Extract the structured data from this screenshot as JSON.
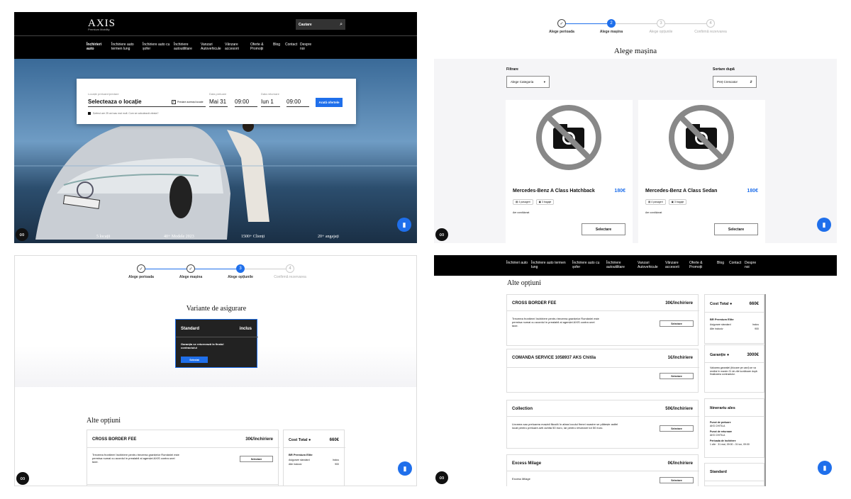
{
  "q1": {
    "brand": "AXIS",
    "brand_sub": "Premium Mobility",
    "search_placeholder": "Cautare",
    "nav": [
      "Închirieri auto",
      "Închiriere auto termen lung",
      "Închiriere auto cu șofer",
      "Închiriere autoutilitare",
      "Vanzari Autovehicule",
      "Vânzare accesorii",
      "Oferte & Promoții",
      "Blog",
      "Contact",
      "Despre noi"
    ],
    "form": {
      "loc_label": "Locație preluare/predare",
      "loc_value": "Selecteaza o locație",
      "same_label": "Predare aceeași locație",
      "pick_label": "Data preluare",
      "pick_date": "Mai 31",
      "pick_time": "09:00",
      "ret_label": "Data returnare",
      "ret_date": "Iun 1",
      "ret_time": "09:00",
      "cta": "Arată ofertele",
      "note": "Șoferul are 25 ani sau mai mult. Cum se calculează vârsta?"
    },
    "stats": [
      "5 locații",
      "40+ Modele 2023",
      "1500+ Clienți",
      "20+ angajați"
    ]
  },
  "steps": [
    "Alege perioada",
    "Alege mașina",
    "Alege opțiunile",
    "Confirmă rezervarea"
  ],
  "q2": {
    "title": "Alege mașina",
    "filter_label": "Filtrare",
    "filter_value": "Alege Categoria",
    "sort_label": "Sortare după",
    "sort_value": "Preț Crescator",
    "cars": [
      {
        "name": "Mercedes-Benz A Class Hatchback",
        "price": "180€",
        "pax": "4 pasageri",
        "bags": "3 bagaje",
        "feat": "Aer condiționat",
        "btn": "Selectare"
      },
      {
        "name": "Mercedes-Benz A Class Sedan",
        "price": "180€",
        "pax": "4 pasageri",
        "bags": "3 bagaje",
        "feat": "Aer condiționat",
        "btn": "Selectare"
      }
    ]
  },
  "q3": {
    "ins_title": "Variante de asigurare",
    "ins_name": "Standard",
    "ins_tag": "inclus",
    "ins_desc": "Garanția se returnează la finalul contractului",
    "ins_btn": "Selectat",
    "opts_title": "Alte opțiuni",
    "opt_name": "CROSS BORDER FEE",
    "opt_price": "30€/închiriere",
    "opt_desc": "Trecerea frontierei închiriere pentru trecerea granițelor României este permisa numai cu acordul in prealabil al agenției AXIS contra unei taxe.",
    "opt_btn": "Selectare",
    "cost_label": "Cost Total",
    "cost_value": "660€",
    "car": "BR Premium Elite",
    "line1": "Asigurare standard",
    "line1v": "Inclus",
    "line2": "Alte inclusiv",
    "line2v": "900"
  },
  "q4": {
    "nav": [
      "Închirieri auto",
      "Închiriere auto termen lung",
      "Închiriere auto cu șofer",
      "Închiriere autoutilitare",
      "Vanzari Autovehicule",
      "Vânzare accesorii",
      "Oferte & Promoții",
      "Blog",
      "Contact",
      "Despre noi"
    ],
    "title": "Alte opțiuni",
    "opts": [
      {
        "name": "CROSS BORDER FEE",
        "price": "30€/închiriere",
        "desc": "Trecerea frontierei închiriere pentru trecerea granițelor României este permisa numai cu acordul in prealabil al agenției AXIS contra unei taxe.",
        "btn": "Selectare"
      },
      {
        "name": "COMANDA SERVICE 1058937 AKS Chitila",
        "price": "1€/închiriere",
        "desc": "",
        "btn": "Selectare"
      },
      {
        "name": "Collection",
        "price": "50€/închiriere",
        "desc": "Livrarea sau preluarea mașinii făcută în afara locului firmei noastre se plătește astfel locat pentru preluare-seti achita 50 euro, iar pentru returnare tot 50 euro.",
        "btn": "Selectare"
      },
      {
        "name": "Excess Milage",
        "price": "0€/închiriere",
        "desc": "Excess Milage",
        "btn": "Selectare"
      }
    ],
    "cost_label": "Cost Total",
    "cost_value": "660€",
    "car": "BR Premium Elite",
    "line1": "Asigurare standard",
    "line1v": "Inclus",
    "line2": "Alte inclusiv",
    "line2v": "900",
    "dep_label": "Garanție",
    "dep_value": "3000€",
    "dep_desc": "Valoarea garanției (blocare pe card) se va restitui în maxim 21 de zile lucrătoare după finalizarea contractului.",
    "itin_title": "Itinerariu ales",
    "pick_t": "Punct de preluare",
    "pick_v": "AKS CHITILA",
    "ret_t": "Punct de returnare",
    "ret_v": "AKS CHITILA",
    "per_t": "Perioada de închiriere",
    "per_v": "1 zile · 31 mai, 09:00 - 01 iun, 09:00",
    "std_title": "Standard"
  }
}
